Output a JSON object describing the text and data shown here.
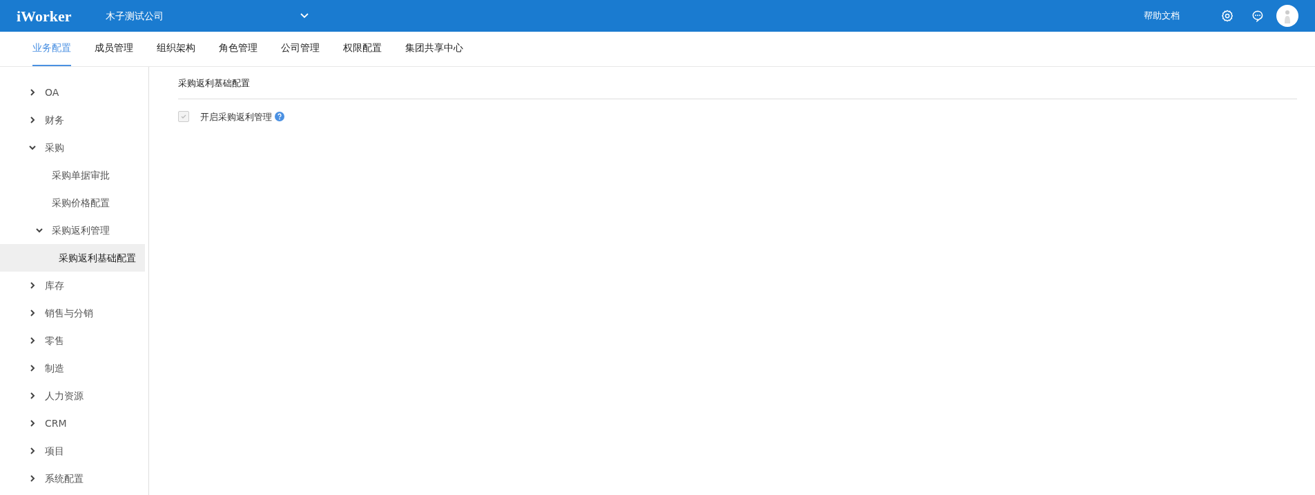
{
  "header": {
    "logo": "iWorker",
    "company": "木子测试公司",
    "help": "帮助文档"
  },
  "tabs": [
    {
      "label": "业务配置",
      "selected": true
    },
    {
      "label": "成员管理",
      "selected": false
    },
    {
      "label": "组织架构",
      "selected": false
    },
    {
      "label": "角色管理",
      "selected": false
    },
    {
      "label": "公司管理",
      "selected": false
    },
    {
      "label": "权限配置",
      "selected": false
    },
    {
      "label": "集团共享中心",
      "selected": false
    }
  ],
  "sidebar": {
    "items": [
      {
        "label": "OA",
        "expanded": false,
        "selected": false
      },
      {
        "label": "财务",
        "expanded": false,
        "selected": false
      },
      {
        "label": "采购",
        "expanded": true,
        "selected": false,
        "children": [
          {
            "label": "采购单据审批",
            "selected": false
          },
          {
            "label": "采购价格配置",
            "selected": false
          },
          {
            "label": "采购返利管理",
            "expanded": true,
            "selected": false,
            "children": [
              {
                "label": "采购返利基础配置",
                "selected": true
              }
            ]
          }
        ]
      },
      {
        "label": "库存",
        "expanded": false,
        "selected": false
      },
      {
        "label": "销售与分销",
        "expanded": false,
        "selected": false
      },
      {
        "label": "零售",
        "expanded": false,
        "selected": false
      },
      {
        "label": "制造",
        "expanded": false,
        "selected": false
      },
      {
        "label": "人力资源",
        "expanded": false,
        "selected": false
      },
      {
        "label": "CRM",
        "expanded": false,
        "selected": false
      },
      {
        "label": "项目",
        "expanded": false,
        "selected": false
      },
      {
        "label": "系统配置",
        "expanded": false,
        "selected": false
      }
    ]
  },
  "content": {
    "title": "采购返利基础配置",
    "option": {
      "label": "开启采购返利管理",
      "checked": true,
      "disabled": true
    }
  }
}
